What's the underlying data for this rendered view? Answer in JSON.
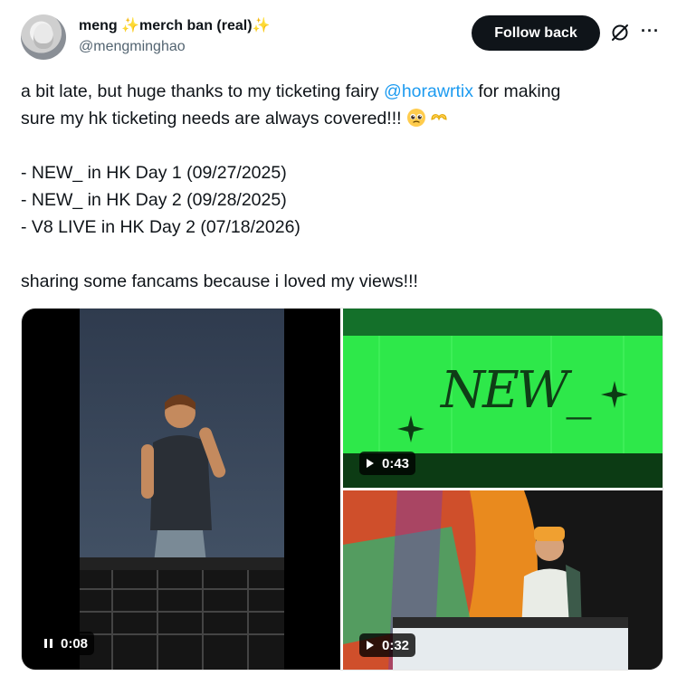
{
  "author": {
    "display_name_a": "meng ",
    "display_name_b": "merch ban (real)",
    "handle": "@mengminghao",
    "avatar_icon": "profile-avatar"
  },
  "actions": {
    "follow_label": "Follow back",
    "grok_icon": "grok-icon",
    "more_icon": "more-options-icon",
    "more_glyph": "···"
  },
  "tweet": {
    "line1_pre": "a bit late, but huge thanks to my ticketing fairy ",
    "mention": "@horawrtix",
    "line1_post": " for making",
    "line2": "sure my hk ticketing needs are always covered!!! ",
    "list": [
      "- NEW_ in HK Day 1 (09/27/2025)",
      "- NEW_ in HK Day 2 (09/28/2025)",
      "- V8 LIVE in HK Day 2 (07/18/2026)"
    ],
    "closing": "sharing some fancams because i loved my views!!!"
  },
  "media": [
    {
      "duration": "0:08",
      "state": "pause-icon"
    },
    {
      "duration": "0:43",
      "state": "play-icon",
      "screen_text": "NEW_"
    },
    {
      "duration": "0:32",
      "state": "play-icon"
    }
  ],
  "colors": {
    "text": "#0f1419",
    "secondary": "#536471",
    "link": "#1d9bf0",
    "sparkle": "#f5b400",
    "stage_green": "#2ee84a"
  }
}
